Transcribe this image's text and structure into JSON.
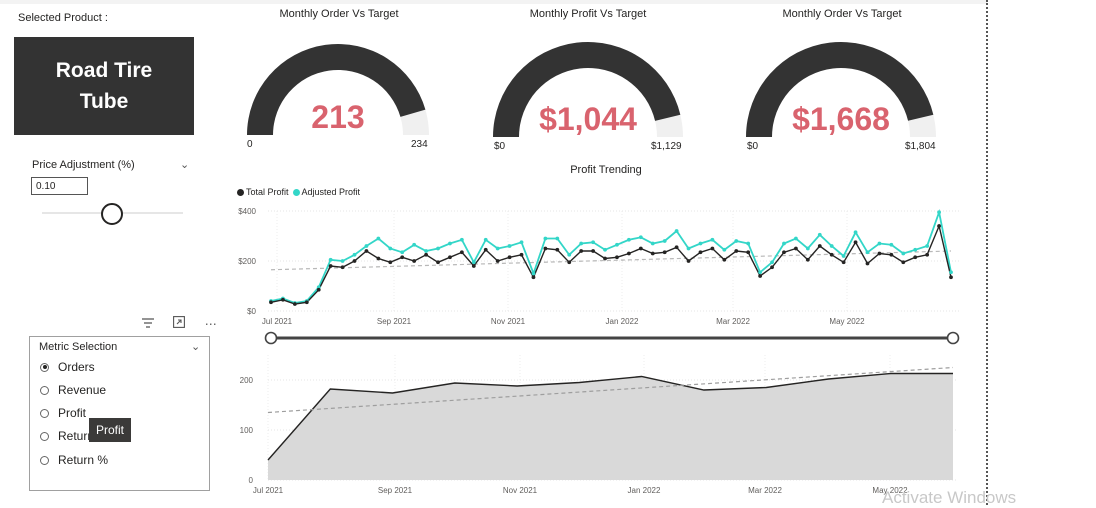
{
  "selected_product": {
    "label": "Selected Product :",
    "value": "Road Tire Tube"
  },
  "price_adjustment": {
    "label": "Price Adjustment (%)",
    "value": "0.10",
    "slider_fraction": 0.55
  },
  "visual_icons": {
    "filter": "filter-icon",
    "focus": "focus-mode-icon",
    "more": "more-options-icon"
  },
  "metric_selection": {
    "title": "Metric Selection",
    "options": [
      {
        "label": "Orders",
        "selected": true
      },
      {
        "label": "Revenue",
        "selected": false
      },
      {
        "label": "Profit",
        "selected": false
      },
      {
        "label": "Returns",
        "selected": false
      },
      {
        "label": "Return %",
        "selected": false
      }
    ],
    "tooltip": "Profit"
  },
  "gauges": [
    {
      "title": "Monthly Order Vs Target",
      "value": 213,
      "display": "213",
      "min_label": "0",
      "max_label": "234",
      "max": 234
    },
    {
      "title": "Monthly Profit Vs Target",
      "value": 1044,
      "display": "$1,044",
      "min_label": "$0",
      "max_label": "$1,129",
      "max": 1129
    },
    {
      "title": "Monthly Order Vs Target",
      "value": 1668,
      "display": "$1,668",
      "min_label": "$0",
      "max_label": "$1,804",
      "max": 1804
    }
  ],
  "colors": {
    "gauge_fill": "#333333",
    "gauge_bg": "#f0f0f0",
    "kpi": "#d9636e",
    "total": "#252423",
    "adjusted": "#33d6c8",
    "area": "#d9d9d9",
    "card": "#333333"
  },
  "watermark": "Activate Windows",
  "chart_data": [
    {
      "type": "line",
      "title": "Profit Trending",
      "legend_placement": "top-left",
      "grid": true,
      "x_tick_labels": [
        "Jul 2021",
        "Sep 2021",
        "Nov 2021",
        "Jan 2022",
        "Mar 2022",
        "May 2022"
      ],
      "y_tick_labels": [
        "$0",
        "$200",
        "$400"
      ],
      "ylim": [
        0,
        400
      ],
      "x_range": [
        "2021-07-01",
        "2022-06-30"
      ],
      "x": [
        "2021-07-01",
        "2021-07-08",
        "2021-07-15",
        "2021-07-22",
        "2021-07-29",
        "2021-08-05",
        "2021-08-12",
        "2021-08-19",
        "2021-08-26",
        "2021-09-02",
        "2021-09-09",
        "2021-09-16",
        "2021-09-23",
        "2021-09-30",
        "2021-10-07",
        "2021-10-14",
        "2021-10-21",
        "2021-10-28",
        "2021-11-04",
        "2021-11-11",
        "2021-11-18",
        "2021-11-25",
        "2021-12-02",
        "2021-12-09",
        "2021-12-16",
        "2021-12-23",
        "2021-12-30",
        "2022-01-06",
        "2022-01-13",
        "2022-01-20",
        "2022-01-27",
        "2022-02-03",
        "2022-02-10",
        "2022-02-17",
        "2022-02-24",
        "2022-03-03",
        "2022-03-10",
        "2022-03-17",
        "2022-03-24",
        "2022-03-31",
        "2022-04-07",
        "2022-04-14",
        "2022-04-21",
        "2022-04-28",
        "2022-05-05",
        "2022-05-12",
        "2022-05-19",
        "2022-05-26",
        "2022-06-02",
        "2022-06-09",
        "2022-06-16",
        "2022-06-23",
        "2022-06-30"
      ],
      "series": [
        {
          "name": "Total Profit",
          "values": [
            35,
            45,
            28,
            35,
            85,
            180,
            175,
            200,
            240,
            210,
            195,
            215,
            200,
            225,
            195,
            215,
            235,
            180,
            245,
            200,
            215,
            225,
            135,
            250,
            245,
            195,
            240,
            240,
            210,
            215,
            230,
            250,
            230,
            235,
            255,
            200,
            235,
            250,
            205,
            240,
            235,
            140,
            175,
            235,
            250,
            205,
            260,
            225,
            195,
            275,
            190,
            230,
            225,
            195,
            215,
            225,
            340,
            135
          ]
        },
        {
          "name": "Adjusted Profit",
          "values": [
            40,
            50,
            32,
            40,
            95,
            205,
            200,
            225,
            260,
            290,
            250,
            235,
            265,
            240,
            250,
            270,
            285,
            195,
            285,
            250,
            260,
            275,
            150,
            290,
            290,
            225,
            270,
            275,
            245,
            265,
            285,
            295,
            270,
            280,
            320,
            250,
            270,
            285,
            245,
            280,
            270,
            155,
            195,
            270,
            290,
            250,
            305,
            260,
            220,
            315,
            235,
            270,
            265,
            230,
            245,
            260,
            395,
            155
          ]
        },
        {
          "name": "trend",
          "values": [
            165,
            240
          ]
        }
      ]
    },
    {
      "type": "area",
      "x_tick_labels": [
        "Jul 2021",
        "Sep 2021",
        "Nov 2021",
        "Jan 2022",
        "Mar 2022",
        "May 2022"
      ],
      "y_tick_labels": [
        "0",
        "100",
        "200"
      ],
      "ylim": [
        0,
        250
      ],
      "x": [
        "Jul 2021",
        "Aug 2021",
        "Sep 2021",
        "Oct 2021",
        "Nov 2021",
        "Dec 2021",
        "Jan 2022",
        "Feb 2022",
        "Mar 2022",
        "Apr 2022",
        "May 2022",
        "Jun 2022"
      ],
      "series": [
        {
          "name": "Orders",
          "values": [
            40,
            182,
            174,
            194,
            188,
            195,
            207,
            180,
            185,
            202,
            213,
            213
          ]
        },
        {
          "name": "trend",
          "values": [
            135,
            225
          ]
        }
      ]
    }
  ]
}
